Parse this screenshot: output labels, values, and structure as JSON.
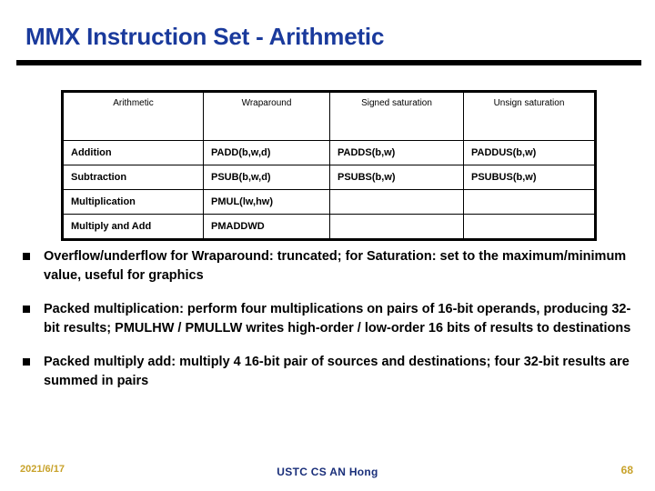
{
  "slide": {
    "title": "MMX Instruction Set - Arithmetic"
  },
  "table": {
    "headers": [
      "Arithmetic",
      "Wraparound",
      "Signed saturation",
      "Unsign saturation"
    ],
    "rows": [
      [
        "Addition",
        "PADD(b,w,d)",
        "PADDS(b,w)",
        "PADDUS(b,w)"
      ],
      [
        "Subtraction",
        "PSUB(b,w,d)",
        "PSUBS(b,w)",
        "PSUBUS(b,w)"
      ],
      [
        "Multiplication",
        "PMUL(lw,hw)",
        "",
        ""
      ],
      [
        "Multiply and Add",
        "PMADDWD",
        "",
        ""
      ]
    ]
  },
  "bullets": [
    "Overflow/underflow for Wraparound: truncated; for Saturation: set to the maximum/minimum value, useful for graphics",
    "Packed multiplication: perform four multiplications on pairs of 16-bit operands, producing 32-bit results; PMULHW / PMULLW writes high-order / low-order 16 bits of results to destinations",
    "Packed multiply add: multiply 4 16-bit pair of sources and destinations; four 32-bit results are summed in pairs"
  ],
  "footer": {
    "date": "2021/6/17",
    "center": "USTC CS AN Hong",
    "page": "68"
  },
  "colors": {
    "title_blue": "#1a3a9c",
    "footer_gold": "#c8a22a",
    "footer_blue": "#1a2f7a",
    "rule_black": "#000000"
  }
}
